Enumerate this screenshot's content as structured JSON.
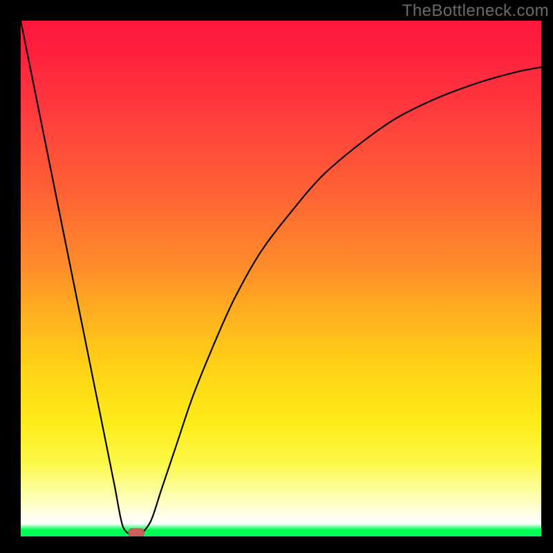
{
  "watermark": "TheBottleneck.com",
  "chart_data": {
    "type": "line",
    "title": "",
    "xlabel": "",
    "ylabel": "",
    "xlim": [
      0,
      100
    ],
    "ylim": [
      0,
      100
    ],
    "curve": {
      "name": "bottleneck-curve",
      "x": [
        0,
        2,
        4,
        6,
        8,
        10,
        12,
        14,
        16,
        18,
        19.6,
        21.5,
        22.2,
        23.0,
        25,
        27,
        30,
        33,
        37,
        41,
        46,
        52,
        58,
        65,
        72,
        80,
        88,
        95,
        100
      ],
      "y": [
        100,
        90,
        80,
        70,
        60,
        50,
        40,
        30,
        20,
        10,
        2,
        0.2,
        0,
        0.3,
        3,
        9,
        18,
        27,
        37,
        46,
        55,
        63,
        70,
        76,
        81,
        85,
        88,
        90,
        91
      ]
    },
    "marker": {
      "x": 22.2,
      "y": 0.7,
      "name": "bottleneck-point"
    },
    "gradient_stops": [
      {
        "pos": 0.0,
        "color": "#ff173c"
      },
      {
        "pos": 0.35,
        "color": "#ff6a32"
      },
      {
        "pos": 0.7,
        "color": "#fde81a"
      },
      {
        "pos": 0.95,
        "color": "#ffffff"
      },
      {
        "pos": 1.0,
        "color": "#00fe55"
      }
    ]
  }
}
